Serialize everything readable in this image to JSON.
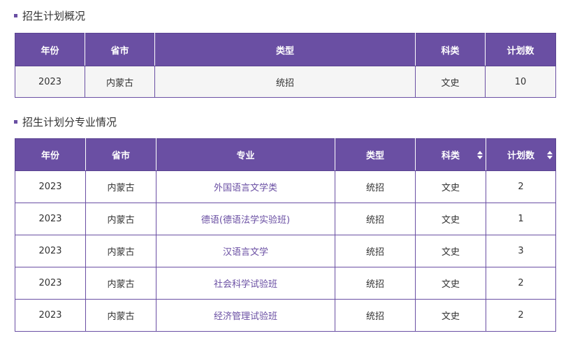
{
  "section1": {
    "title": "招生计划概况",
    "headers": [
      "年份",
      "省市",
      "类型",
      "科类",
      "计划数"
    ],
    "rows": [
      [
        "2023",
        "内蒙古",
        "统招",
        "文史",
        "10"
      ]
    ]
  },
  "section2": {
    "title": "招生计划分专业情况",
    "headers": [
      "年份",
      "省市",
      "专业",
      "类型",
      "科类",
      "计划数"
    ],
    "rows": [
      [
        "2023",
        "内蒙古",
        "外国语言文学类",
        "统招",
        "文史",
        "2"
      ],
      [
        "2023",
        "内蒙古",
        "德语(德语法学实验班)",
        "统招",
        "文史",
        "1"
      ],
      [
        "2023",
        "内蒙古",
        "汉语言文学",
        "统招",
        "文史",
        "3"
      ],
      [
        "2023",
        "内蒙古",
        "社会科学试验班",
        "统招",
        "文史",
        "2"
      ],
      [
        "2023",
        "内蒙古",
        "经济管理试验班",
        "统招",
        "文史",
        "2"
      ]
    ]
  },
  "colors": {
    "accent": "#6a4fa3",
    "header_text": "#ffffff",
    "row_bg": "#f5f5f5"
  },
  "icons": [
    "sort-icon"
  ]
}
